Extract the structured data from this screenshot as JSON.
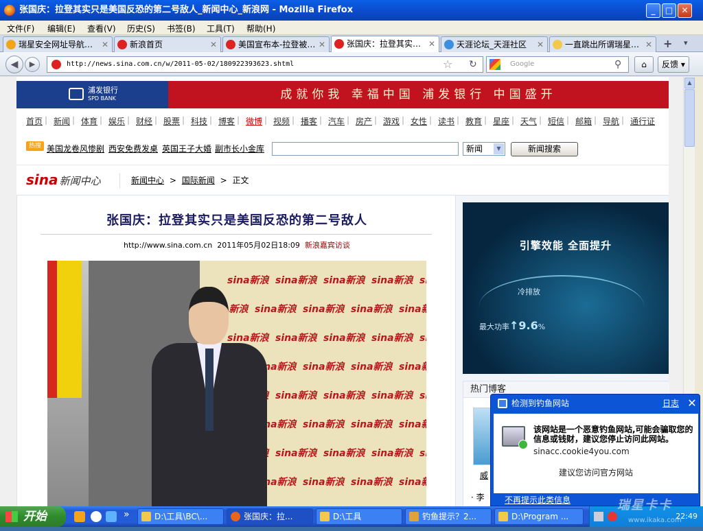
{
  "window": {
    "title": "张国庆：拉登其实只是美国反恐的第二号敌人_新闻中心_新浪网 - Mozilla Firefox",
    "minimize": "_",
    "maximize": "□",
    "close": "✕"
  },
  "menu": [
    "文件(F)",
    "编辑(E)",
    "查看(V)",
    "历史(S)",
    "书签(B)",
    "工具(T)",
    "帮助(H)"
  ],
  "tabs": [
    {
      "label": "瑞星安全网址导航…",
      "close": "✕"
    },
    {
      "label": "新浪首页",
      "close": "✕"
    },
    {
      "label": "美国宣布本-拉登被…",
      "close": "✕"
    },
    {
      "label": "张国庆：拉登其实…",
      "close": "✕"
    },
    {
      "label": "天涯论坛_天涯社区",
      "close": "✕"
    },
    {
      "label": "一直跳出所谓瑞星…",
      "close": "✕"
    }
  ],
  "new_tab": "+",
  "tab_list": "▾",
  "nav": {
    "back": "◀",
    "forward": "▶",
    "url": "http://news.sina.com.cn/w/2011-05-02/180922393623.shtml",
    "bookmark_star": "☆",
    "reload": "↻",
    "search_placeholder": "Google",
    "search_glass": "⚲",
    "home": "⌂",
    "feedback": "反馈 ▾"
  },
  "banner": {
    "bank_name_cn": "浦发银行",
    "bank_name_en": "SPD BANK",
    "slogan": "成就你我 幸福中国 浦发银行 中国盛开"
  },
  "channels": [
    "首页",
    "新闻",
    "体育",
    "娱乐",
    "财经",
    "股票",
    "科技",
    "博客",
    "微博",
    "视频",
    "播客",
    "汽车",
    "房产",
    "游戏",
    "女性",
    "读书",
    "教育",
    "星座",
    "天气",
    "短信",
    "邮箱",
    "导航",
    "通行证"
  ],
  "hot": {
    "badge": "热搜",
    "links": [
      "美国龙卷风惨剧",
      "西安免费发桌",
      "英国王子大婚",
      "副市长小金库"
    ],
    "select_value": "新闻",
    "select_arrow": "▼",
    "submit": "新闻搜索"
  },
  "sina": {
    "logo": "sina",
    "center": "新闻中心",
    "breadcrumb": [
      "新闻中心",
      "国际新闻",
      "正文"
    ],
    "crumb_sep": ">"
  },
  "article": {
    "title": "张国庆：拉登其实只是美国反恐的第二号敌人",
    "source_url": "http://www.sina.com.cn",
    "datetime": "2011年05月02日18:09",
    "column": "新浪嘉宾访谈",
    "backdrop_text": "sina新浪"
  },
  "ad": {
    "headline": "引擎效能 全面提升",
    "line2": "冷排放",
    "power_label": "最大功率",
    "power_value": "9.6",
    "power_unit": "%",
    "arrow": "↑"
  },
  "blog": {
    "header": "热门博客",
    "name": "威",
    "list_item": "· 李"
  },
  "popup": {
    "title": "检测到钓鱼网站",
    "log": "日志",
    "close": "✕",
    "warning": "该网站是一个恶意钓鱼网站,可能会骗取您的信息或钱财，建议您停止访问此网站。",
    "domain": "sinacc.cookie4you.com",
    "advice": "建议您访问官方网站",
    "footer": "不再提示此类信息"
  },
  "taskbar": {
    "start": "开始",
    "more": "»",
    "tasks": [
      {
        "label": "D:\\工具\\BC\\..."
      },
      {
        "label": "张国庆：拉..."
      },
      {
        "label": "D:\\工具"
      },
      {
        "label": "钓鱼提示？2..."
      },
      {
        "label": "D:\\Program ..."
      }
    ],
    "clock": "22:49",
    "watermark": "瑞星卡卡",
    "watermark_site": "www.ikaka.com"
  },
  "scroll": {
    "up": "▲",
    "down": "▼"
  }
}
